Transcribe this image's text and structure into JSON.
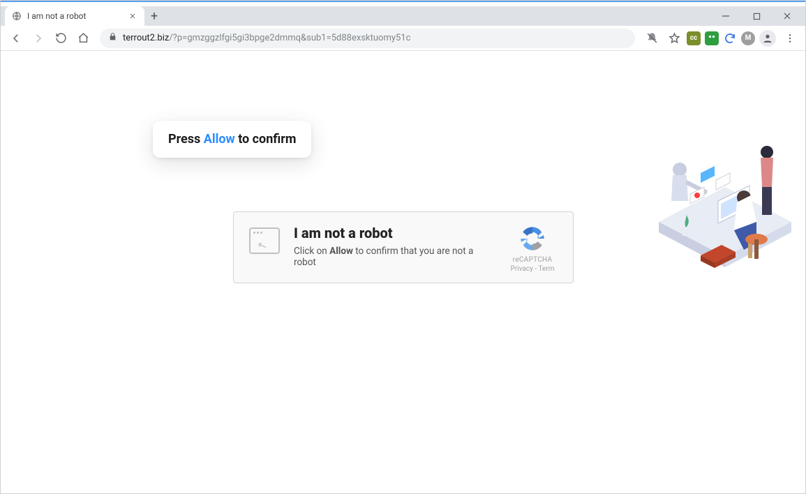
{
  "tab": {
    "title": "I am not a robot"
  },
  "omnibox": {
    "domain": "terrout2.biz",
    "path": "/?p=gmzggzlfgi5gi3bpge2dmmq&sub1=5d88exsktuomy51c"
  },
  "bubble": {
    "prefix": "Press ",
    "allow": "Allow",
    "suffix": " to confirm"
  },
  "captcha": {
    "title": "I am not a robot",
    "text_prefix": "Click on ",
    "text_bold": "Allow",
    "text_suffix": " to confirm that you are not a robot",
    "badge_label": "reCAPTCHA",
    "privacy": "Privacy",
    "terms": "Term"
  },
  "extensions": {
    "cc": "cc",
    "m": "M"
  }
}
